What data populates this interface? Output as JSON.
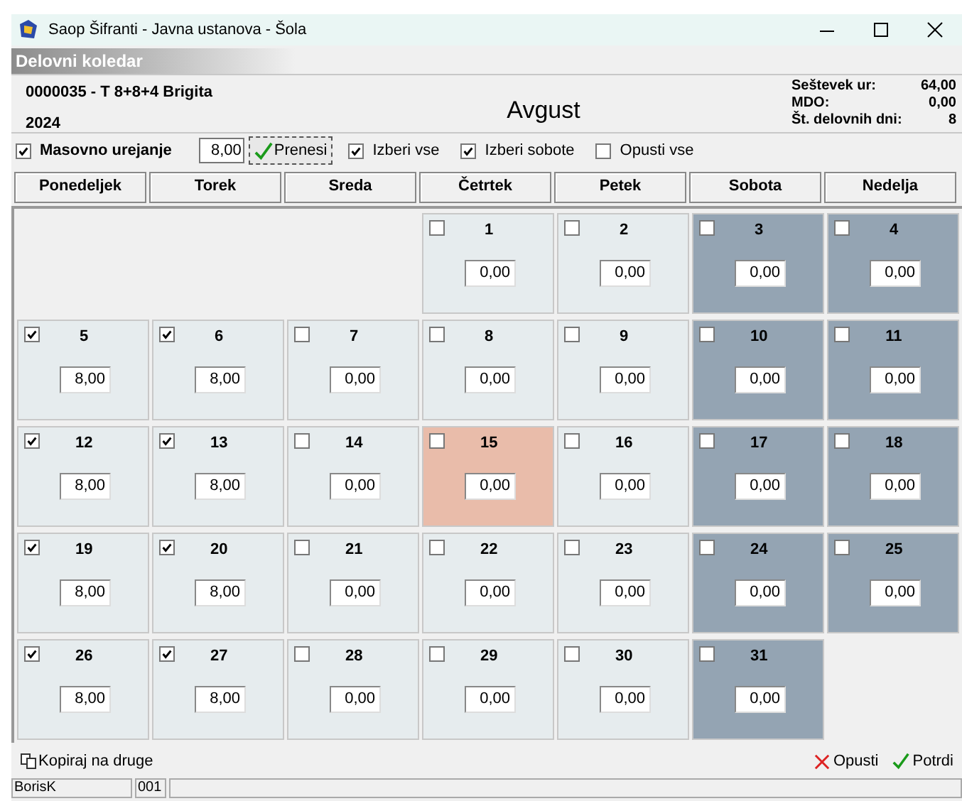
{
  "window": {
    "title": "Saop Šifranti - Javna ustanova - Šola"
  },
  "section_title": "Delovni koledar",
  "header": {
    "employee": "0000035 - T  8+8+4 Brigita",
    "year": "2024",
    "month": "Avgust",
    "totals": [
      {
        "label": "Seštevek ur:",
        "value": "64,00"
      },
      {
        "label": "MDO:",
        "value": "0,00"
      },
      {
        "label": "Št. delovnih dni:",
        "value": "8"
      }
    ]
  },
  "toolbar": {
    "bulk_edit": {
      "label": "Masovno urejanje",
      "checked": true
    },
    "hours_value": "8,00",
    "apply_button": "Prenesi",
    "options": [
      {
        "label": "Izberi vse",
        "checked": true
      },
      {
        "label": "Izberi sobote",
        "checked": true
      },
      {
        "label": "Opusti vse",
        "checked": false
      }
    ]
  },
  "weekdays": [
    "Ponedeljek",
    "Torek",
    "Sreda",
    "Četrtek",
    "Petek",
    "Sobota",
    "Nedelja"
  ],
  "weeks": [
    {
      "days": [
        {
          "day": "1",
          "hours": "0,00",
          "checked": false,
          "kind": "workday"
        },
        {
          "day": "2",
          "hours": "0,00",
          "checked": false,
          "kind": "workday"
        },
        {
          "day": "3",
          "hours": "0,00",
          "checked": false,
          "kind": "weekend"
        },
        {
          "day": "4",
          "hours": "0,00",
          "checked": false,
          "kind": "weekend"
        }
      ]
    },
    {
      "days": [
        {
          "day": "5",
          "hours": "8,00",
          "checked": true,
          "kind": "workday"
        },
        {
          "day": "6",
          "hours": "8,00",
          "checked": true,
          "kind": "workday"
        },
        {
          "day": "7",
          "hours": "0,00",
          "checked": false,
          "kind": "workday"
        },
        {
          "day": "8",
          "hours": "0,00",
          "checked": false,
          "kind": "workday"
        },
        {
          "day": "9",
          "hours": "0,00",
          "checked": false,
          "kind": "workday"
        },
        {
          "day": "10",
          "hours": "0,00",
          "checked": false,
          "kind": "weekend"
        },
        {
          "day": "11",
          "hours": "0,00",
          "checked": false,
          "kind": "weekend"
        }
      ]
    },
    {
      "days": [
        {
          "day": "12",
          "hours": "8,00",
          "checked": true,
          "kind": "workday"
        },
        {
          "day": "13",
          "hours": "8,00",
          "checked": true,
          "kind": "workday"
        },
        {
          "day": "14",
          "hours": "0,00",
          "checked": false,
          "kind": "workday"
        },
        {
          "day": "15",
          "hours": "0,00",
          "checked": false,
          "kind": "holiday"
        },
        {
          "day": "16",
          "hours": "0,00",
          "checked": false,
          "kind": "workday"
        },
        {
          "day": "17",
          "hours": "0,00",
          "checked": false,
          "kind": "weekend"
        },
        {
          "day": "18",
          "hours": "0,00",
          "checked": false,
          "kind": "weekend"
        }
      ]
    },
    {
      "days": [
        {
          "day": "19",
          "hours": "8,00",
          "checked": true,
          "kind": "workday"
        },
        {
          "day": "20",
          "hours": "8,00",
          "checked": true,
          "kind": "workday"
        },
        {
          "day": "21",
          "hours": "0,00",
          "checked": false,
          "kind": "workday"
        },
        {
          "day": "22",
          "hours": "0,00",
          "checked": false,
          "kind": "workday"
        },
        {
          "day": "23",
          "hours": "0,00",
          "checked": false,
          "kind": "workday"
        },
        {
          "day": "24",
          "hours": "0,00",
          "checked": false,
          "kind": "weekend"
        },
        {
          "day": "25",
          "hours": "0,00",
          "checked": false,
          "kind": "weekend"
        }
      ]
    },
    {
      "days": [
        {
          "day": "26",
          "hours": "8,00",
          "checked": true,
          "kind": "workday"
        },
        {
          "day": "27",
          "hours": "8,00",
          "checked": true,
          "kind": "workday"
        },
        {
          "day": "28",
          "hours": "0,00",
          "checked": false,
          "kind": "workday"
        },
        {
          "day": "29",
          "hours": "0,00",
          "checked": false,
          "kind": "workday"
        },
        {
          "day": "30",
          "hours": "0,00",
          "checked": false,
          "kind": "workday"
        },
        {
          "day": "31",
          "hours": "0,00",
          "checked": false,
          "kind": "weekend"
        }
      ]
    }
  ],
  "footer": {
    "copy_button": "Kopiraj na druge",
    "cancel_button": "Opusti",
    "confirm_button": "Potrdi"
  },
  "status_bar": [
    "BorisK",
    "001"
  ]
}
